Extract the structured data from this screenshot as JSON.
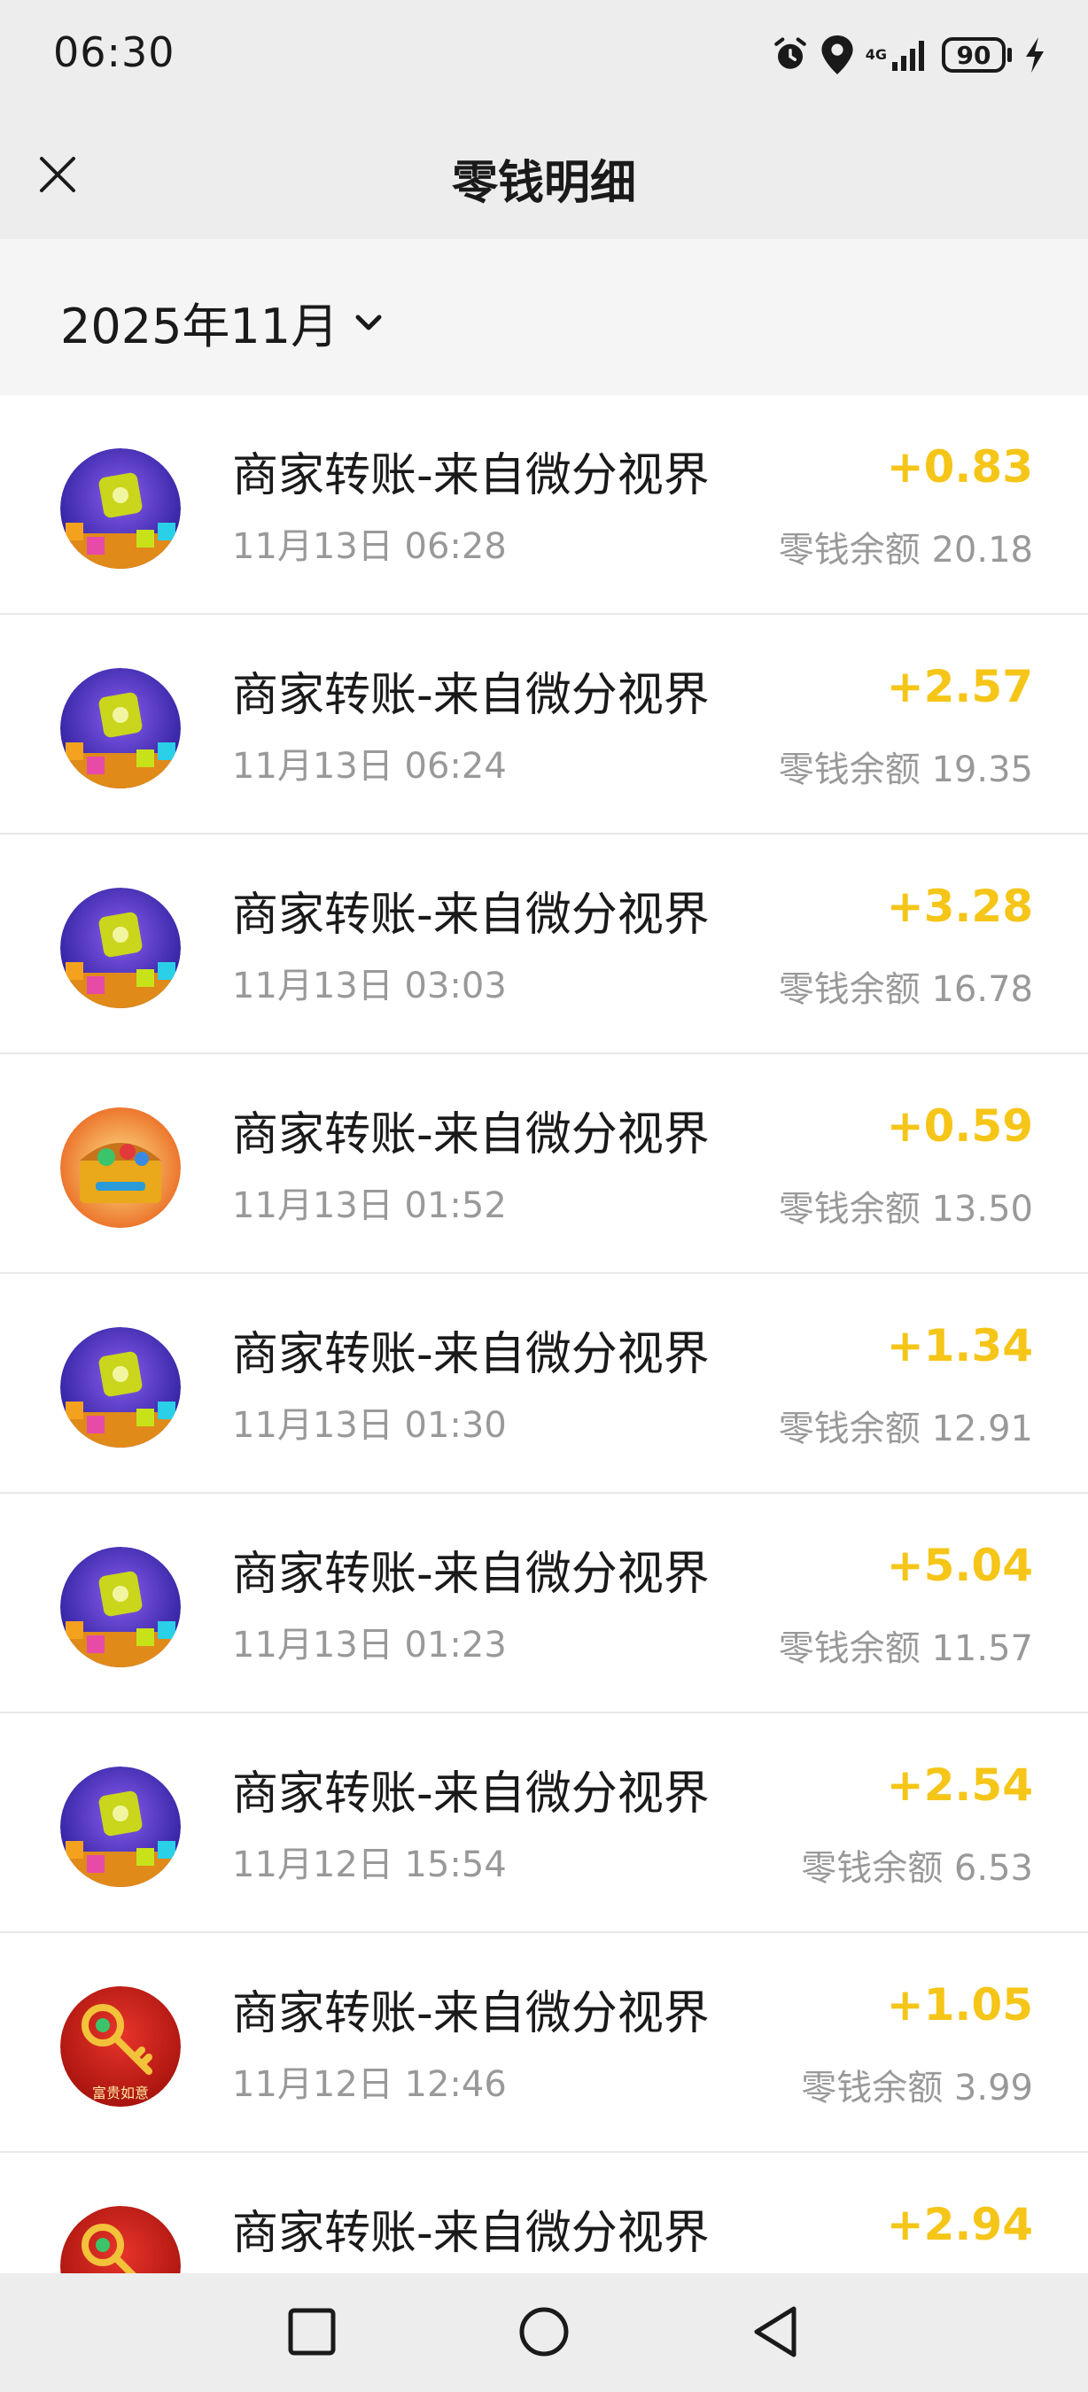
{
  "status_bar": {
    "time": "06:30",
    "network": "4G",
    "battery": "90",
    "icons": [
      "alarm-icon",
      "location-icon",
      "signal-icon",
      "battery-icon",
      "charging-icon"
    ]
  },
  "header": {
    "title": "零钱明细",
    "close_icon": "close-icon"
  },
  "filter": {
    "month": "2025年11月",
    "dropdown_icon": "chevron-down-icon"
  },
  "colors": {
    "amount": "#f5c518",
    "header_bg": "#ededed",
    "month_bg": "#f5f5f5"
  },
  "transactions": [
    {
      "title": "商家转账-来自微分视界",
      "time": "11月13日 06:28",
      "amount": "+0.83",
      "balance": "零钱余额 20.18",
      "icon": "puzzle-game-icon"
    },
    {
      "title": "商家转账-来自微分视界",
      "time": "11月13日 06:24",
      "amount": "+2.57",
      "balance": "零钱余额 19.35",
      "icon": "puzzle-game-icon"
    },
    {
      "title": "商家转账-来自微分视界",
      "time": "11月13日 03:03",
      "amount": "+3.28",
      "balance": "零钱余额 16.78",
      "icon": "puzzle-game-icon"
    },
    {
      "title": "商家转账-来自微分视界",
      "time": "11月13日 01:52",
      "amount": "+0.59",
      "balance": "零钱余额 13.50",
      "icon": "treasure-chest-icon"
    },
    {
      "title": "商家转账-来自微分视界",
      "time": "11月13日 01:30",
      "amount": "+1.34",
      "balance": "零钱余额 12.91",
      "icon": "puzzle-game-icon"
    },
    {
      "title": "商家转账-来自微分视界",
      "time": "11月13日 01:23",
      "amount": "+5.04",
      "balance": "零钱余额 11.57",
      "icon": "puzzle-game-icon"
    },
    {
      "title": "商家转账-来自微分视界",
      "time": "11月12日 15:54",
      "amount": "+2.54",
      "balance": "零钱余额 6.53",
      "icon": "puzzle-game-icon"
    },
    {
      "title": "商家转账-来自微分视界",
      "time": "11月12日 12:46",
      "amount": "+1.05",
      "balance": "零钱余额 3.99",
      "icon": "golden-key-icon",
      "icon_caption": "富贵如意"
    },
    {
      "title": "商家转账-来自微分视界",
      "time": "",
      "amount": "+2.94",
      "balance": "",
      "icon": "golden-key-icon"
    }
  ],
  "system_nav": {
    "recents_icon": "square-icon",
    "home_icon": "circle-icon",
    "back_icon": "triangle-back-icon"
  }
}
